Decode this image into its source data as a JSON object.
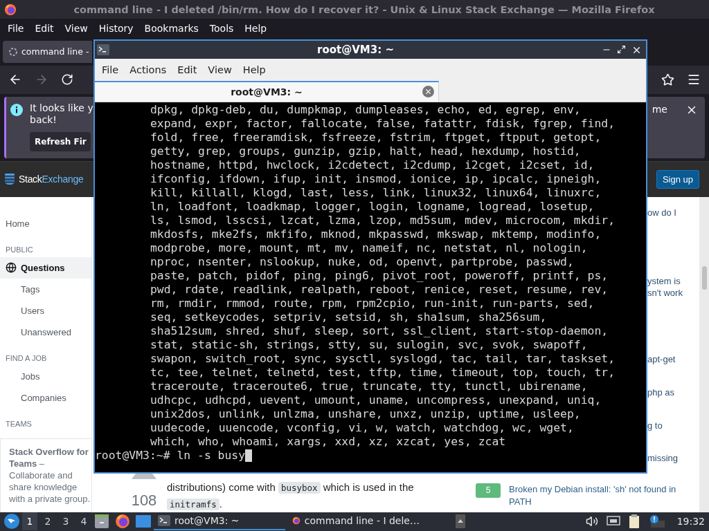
{
  "firefox": {
    "title": "command line - I deleted /bin/rm. How do I recover it? - Unix & Linux Stack Exchange — Mozilla Firefox",
    "menu": [
      "File",
      "Edit",
      "View",
      "History",
      "Bookmarks",
      "Tools",
      "Help"
    ],
    "tab": {
      "label": "command line -"
    },
    "notification": {
      "line1": "It looks like y",
      "line2": "back!",
      "line1_end": "me",
      "button": "Refresh Fir"
    }
  },
  "site": {
    "logo": {
      "first": "Stack",
      "second": "Exchange"
    },
    "signup": "Sign up",
    "sidebar": [
      {
        "kind": "link",
        "label": "Home",
        "selected": false
      },
      {
        "kind": "heading",
        "label": "PUBLIC"
      },
      {
        "kind": "link",
        "label": "Questions",
        "selected": true
      },
      {
        "kind": "sublink",
        "label": "Tags",
        "selected": false
      },
      {
        "kind": "sublink",
        "label": "Users",
        "selected": false
      },
      {
        "kind": "sublink",
        "label": "Unanswered",
        "selected": false
      },
      {
        "kind": "heading",
        "label": "FIND A JOB"
      },
      {
        "kind": "sublink",
        "label": "Jobs",
        "selected": false
      },
      {
        "kind": "sublink",
        "label": "Companies",
        "selected": false
      },
      {
        "kind": "heading",
        "label": "TEAMS"
      }
    ],
    "teams_card": "**Stack Overflow for Teams** – Collaborate and share knowledge with a private group.",
    "vote_count": "108",
    "answer": [
      {
        "kind": "plain",
        "text": "distributions) come with "
      },
      {
        "kind": "code",
        "text": "busybox"
      },
      {
        "kind": "plain",
        "text": " which is used in the "
      },
      {
        "kind": "code",
        "text": "initramfs"
      },
      {
        "kind": "plain",
        "text": "."
      }
    ],
    "related_fragments": [
      [
        "ow do I"
      ],
      [
        "ystem is",
        "sn't work"
      ],
      [
        "apt-get"
      ],
      [
        "php as"
      ],
      [
        "g to"
      ],
      [
        "missing"
      ]
    ],
    "related": {
      "score": "5",
      "title": "Broken my Debian install: 'sh' not found in PATH"
    }
  },
  "terminal": {
    "title": "root@VM3: ~",
    "menu": [
      "File",
      "Actions",
      "Edit",
      "View",
      "Help"
    ],
    "tabs": [
      {
        "label": "root@VM3: ~",
        "selected": true
      }
    ],
    "lines": [
      "dpkg, dpkg-deb, du, dumpkmap, dumpleases, echo, ed, egrep, env,",
      "expand, expr, factor, fallocate, false, fatattr, fdisk, fgrep, find,",
      "fold, free, freeramdisk, fsfreeze, fstrim, ftpget, ftpput, getopt,",
      "getty, grep, groups, gunzip, gzip, halt, head, hexdump, hostid,",
      "hostname, httpd, hwclock, i2cdetect, i2cdump, i2cget, i2cset, id,",
      "ifconfig, ifdown, ifup, init, insmod, ionice, ip, ipcalc, ipneigh,",
      "kill, killall, klogd, last, less, link, linux32, linux64, linuxrc,",
      "ln, loadfont, loadkmap, logger, login, logname, logread, losetup,",
      "ls, lsmod, lsscsi, lzcat, lzma, lzop, md5sum, mdev, microcom, mkdir,",
      "mkdosfs, mke2fs, mkfifo, mknod, mkpasswd, mkswap, mktemp, modinfo,",
      "modprobe, more, mount, mt, mv, nameif, nc, netstat, nl, nologin,",
      "nproc, nsenter, nslookup, nuke, od, openvt, partprobe, passwd,",
      "paste, patch, pidof, ping, ping6, pivot_root, poweroff, printf, ps,",
      "pwd, rdate, readlink, realpath, reboot, renice, reset, resume, rev,",
      "rm, rmdir, rmmod, route, rpm, rpm2cpio, run-init, run-parts, sed,",
      "seq, setkeycodes, setpriv, setsid, sh, sha1sum, sha256sum,",
      "sha512sum, shred, shuf, sleep, sort, ssl_client, start-stop-daemon,",
      "stat, static-sh, strings, stty, su, sulogin, svc, svok, swapoff,",
      "swapon, switch_root, sync, sysctl, syslogd, tac, tail, tar, taskset,",
      "tc, tee, telnet, telnetd, test, tftp, time, timeout, top, touch, tr,",
      "traceroute, traceroute6, true, truncate, tty, tunctl, ubirename,",
      "udhcpc, udhcpd, uevent, umount, uname, uncompress, unexpand, uniq,",
      "unix2dos, unlink, unlzma, unshare, unxz, unzip, uptime, usleep,",
      "uudecode, uuencode, vconfig, vi, w, watch, watchdog, wc, wget,",
      "which, who, whoami, xargs, xxd, xz, xzcat, yes, zcat"
    ],
    "prompt": "root@VM3:~# ln -s busy"
  },
  "taskbar": {
    "workspaces": [
      {
        "label": "1",
        "selected": true
      },
      {
        "label": "2",
        "selected": false
      },
      {
        "label": "3",
        "selected": false
      },
      {
        "label": "4",
        "selected": false
      }
    ],
    "tasks": [
      {
        "kind": "terminal",
        "label": "root@VM3: ~",
        "selected": true
      },
      {
        "kind": "browser",
        "label": "command line - I dele…",
        "selected": false
      }
    ],
    "clock": "19:32"
  }
}
